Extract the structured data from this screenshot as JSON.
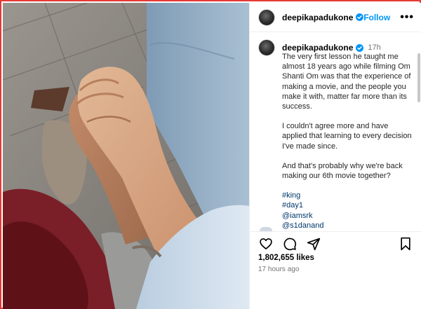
{
  "post": {
    "username": "deepikapadukone",
    "follow_label": "Follow",
    "more_label": "•••",
    "caption_time": "17h",
    "caption_paragraphs": [
      "The very first lesson he taught me almost 18 years ago while filming Om Shanti Om was that the experience of making a movie, and the people you make it with, matter far more than its success.",
      "I couldn't agree more and have applied that learning to every decision I've made since.",
      "And that's probably why we're back making our 6th movie together?"
    ],
    "tags": [
      "#king",
      "#day1",
      "@iamsrk",
      "@s1danand"
    ],
    "likes": "1,802,655 likes",
    "posted_ago": "17 hours ago"
  },
  "icons": {
    "verified": "verified-badge-icon",
    "like": "heart-icon",
    "comment": "comment-icon",
    "share": "share-icon",
    "save": "bookmark-icon"
  },
  "colors": {
    "accent": "#0095f6",
    "verified": "#0095f6",
    "link": "#00376b",
    "frame_border": "#e53935"
  }
}
